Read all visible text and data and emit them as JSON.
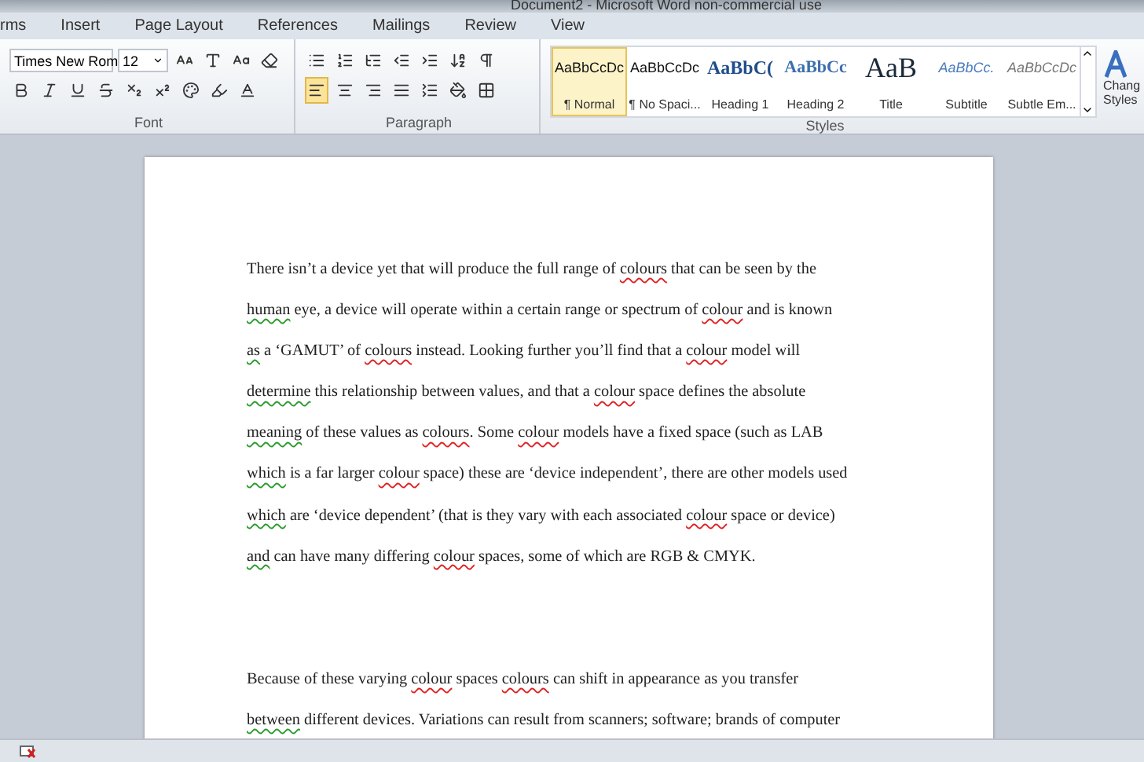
{
  "window": {
    "title": "Document2 - Microsoft Word non-commercial use"
  },
  "tabs": [
    {
      "label": "rms",
      "selected": false
    },
    {
      "label": "Insert",
      "selected": false
    },
    {
      "label": "Page Layout",
      "selected": false
    },
    {
      "label": "References",
      "selected": false
    },
    {
      "label": "Mailings",
      "selected": false
    },
    {
      "label": "Review",
      "selected": false
    },
    {
      "label": "View",
      "selected": false
    }
  ],
  "font_group": {
    "label": "Font",
    "font_name": "Times New Rom",
    "font_size": "12"
  },
  "paragraph_group": {
    "label": "Paragraph",
    "alignment": [
      {
        "kind": "left",
        "selected": true
      },
      {
        "kind": "center",
        "selected": false
      },
      {
        "kind": "right",
        "selected": false
      },
      {
        "kind": "justify",
        "selected": false
      }
    ]
  },
  "styles_group": {
    "label": "Styles",
    "items": [
      {
        "kind": "normal",
        "preview": "AaBbCcDc",
        "name": "¶ Normal",
        "selected": true
      },
      {
        "kind": "normal",
        "preview": "AaBbCcDc",
        "name": "¶ No Spaci...",
        "selected": false
      },
      {
        "kind": "heading1",
        "preview": "AaBbC(",
        "name": "Heading 1",
        "selected": false
      },
      {
        "kind": "heading2",
        "preview": "AaBbCc",
        "name": "Heading 2",
        "selected": false
      },
      {
        "kind": "title",
        "preview": "AaB",
        "name": "Title",
        "selected": false
      },
      {
        "kind": "subtitle",
        "preview": "AaBbCc.",
        "name": "Subtitle",
        "selected": false
      },
      {
        "kind": "emphasis",
        "preview": "AaBbCcDc",
        "name": "Subtle Em...",
        "selected": false
      }
    ],
    "change_styles": [
      "Chang",
      "Styles"
    ]
  },
  "document": {
    "paragraphs": [
      {
        "lines": [
          [
            {
              "kind": "plain",
              "t": "There isn’t a device yet that will produce the full range of "
            },
            {
              "kind": "spelling",
              "t": "colours"
            },
            {
              "kind": "plain",
              "t": " that can be seen by the"
            }
          ],
          [
            {
              "kind": "grammar",
              "t": "human"
            },
            {
              "kind": "plain",
              "t": " eye, a device will operate within a certain range or spectrum of "
            },
            {
              "kind": "spelling",
              "t": "colour"
            },
            {
              "kind": "plain",
              "t": " and is known"
            }
          ],
          [
            {
              "kind": "grammar",
              "t": "as"
            },
            {
              "kind": "plain",
              "t": " a ‘GAMUT’ of "
            },
            {
              "kind": "spelling",
              "t": "colours"
            },
            {
              "kind": "plain",
              "t": " instead. Looking further you’ll find that a "
            },
            {
              "kind": "spelling",
              "t": "colour"
            },
            {
              "kind": "plain",
              "t": " model will"
            }
          ],
          [
            {
              "kind": "grammar",
              "t": "determine"
            },
            {
              "kind": "plain",
              "t": " this relationship between values, and that a "
            },
            {
              "kind": "spelling",
              "t": "colour"
            },
            {
              "kind": "plain",
              "t": " space defines the absolute"
            }
          ],
          [
            {
              "kind": "grammar",
              "t": "meaning"
            },
            {
              "kind": "plain",
              "t": " of these values as "
            },
            {
              "kind": "spelling",
              "t": "colours"
            },
            {
              "kind": "plain",
              "t": ". Some "
            },
            {
              "kind": "spelling",
              "t": "colour"
            },
            {
              "kind": "plain",
              "t": " models have a fixed space (such as LAB"
            }
          ],
          [
            {
              "kind": "grammar",
              "t": "which"
            },
            {
              "kind": "plain",
              "t": " is a far larger "
            },
            {
              "kind": "spelling",
              "t": "colour"
            },
            {
              "kind": "plain",
              "t": " space) these are ‘device independent’, there are other models used"
            }
          ],
          [
            {
              "kind": "grammar",
              "t": "which"
            },
            {
              "kind": "plain",
              "t": " are ‘device dependent’ (that is they vary with each associated "
            },
            {
              "kind": "spelling",
              "t": "colour"
            },
            {
              "kind": "plain",
              "t": " space or device)"
            }
          ],
          [
            {
              "kind": "grammar",
              "t": "and"
            },
            {
              "kind": "plain",
              "t": " can have many differing "
            },
            {
              "kind": "spelling",
              "t": "colour"
            },
            {
              "kind": "plain",
              "t": " spaces, some of which are RGB & CMYK."
            }
          ]
        ]
      },
      {
        "lines": [
          [
            {
              "kind": "plain",
              "t": "Because of these varying "
            },
            {
              "kind": "spelling",
              "t": "colour"
            },
            {
              "kind": "plain",
              "t": " spaces "
            },
            {
              "kind": "spelling",
              "t": "colours"
            },
            {
              "kind": "plain",
              "t": " can shift in appearance as you transfer"
            }
          ],
          [
            {
              "kind": "grammar",
              "t": "between"
            },
            {
              "kind": "plain",
              "t": " different devices. Variations can result from scanners; software; brands of computer"
            }
          ]
        ]
      }
    ]
  }
}
